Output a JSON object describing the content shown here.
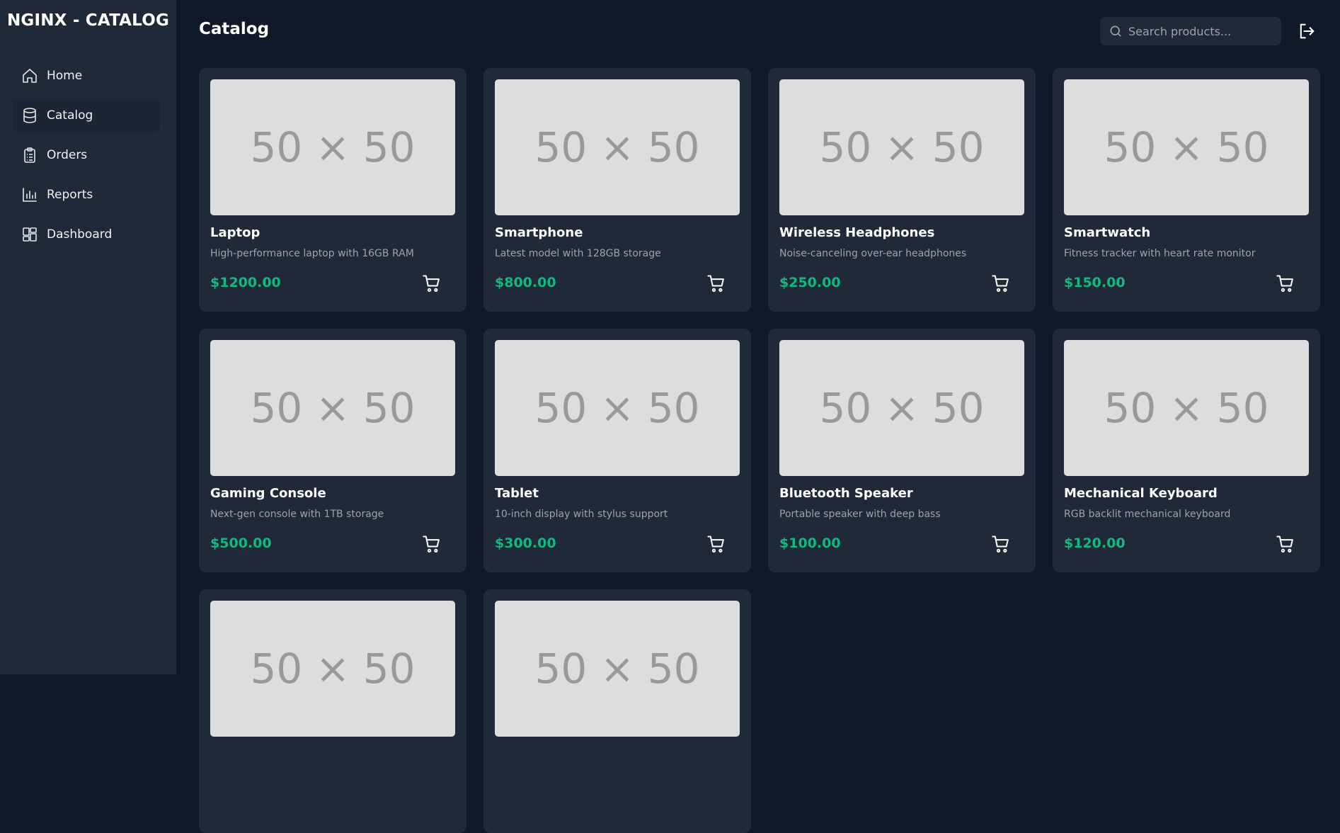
{
  "app": {
    "brand": "NGINX - CATALOG"
  },
  "sidebar": {
    "items": [
      {
        "label": "Home",
        "icon": "home-icon"
      },
      {
        "label": "Catalog",
        "icon": "database-icon",
        "active": true
      },
      {
        "label": "Orders",
        "icon": "clipboard-icon"
      },
      {
        "label": "Reports",
        "icon": "bar-chart-icon"
      },
      {
        "label": "Dashboard",
        "icon": "dashboard-grid-icon"
      }
    ]
  },
  "header": {
    "title": "Catalog",
    "search_placeholder": "Search products...",
    "logout_icon": "logout-icon"
  },
  "colors": {
    "background": "#111827",
    "panel": "#1f2937",
    "price": "#10b981",
    "muted_text": "#9ca3af",
    "placeholder_bg": "#dddddd",
    "placeholder_text": "#999999"
  },
  "products": [
    {
      "image_label": "50 × 50",
      "name": "Laptop",
      "description": "High-performance laptop with 16GB RAM",
      "price": "$1200.00"
    },
    {
      "image_label": "50 × 50",
      "name": "Smartphone",
      "description": "Latest model with 128GB storage",
      "price": "$800.00"
    },
    {
      "image_label": "50 × 50",
      "name": "Wireless Headphones",
      "description": "Noise-canceling over-ear headphones",
      "price": "$250.00"
    },
    {
      "image_label": "50 × 50",
      "name": "Smartwatch",
      "description": "Fitness tracker with heart rate monitor",
      "price": "$150.00"
    },
    {
      "image_label": "50 × 50",
      "name": "Gaming Console",
      "description": "Next-gen console with 1TB storage",
      "price": "$500.00"
    },
    {
      "image_label": "50 × 50",
      "name": "Tablet",
      "description": "10-inch display with stylus support",
      "price": "$300.00"
    },
    {
      "image_label": "50 × 50",
      "name": "Bluetooth Speaker",
      "description": "Portable speaker with deep bass",
      "price": "$100.00"
    },
    {
      "image_label": "50 × 50",
      "name": "Mechanical Keyboard",
      "description": "RGB backlit mechanical keyboard",
      "price": "$120.00"
    },
    {
      "image_label": "50 × 50",
      "name": "",
      "description": "",
      "price": ""
    },
    {
      "image_label": "50 × 50",
      "name": "",
      "description": "",
      "price": ""
    }
  ]
}
